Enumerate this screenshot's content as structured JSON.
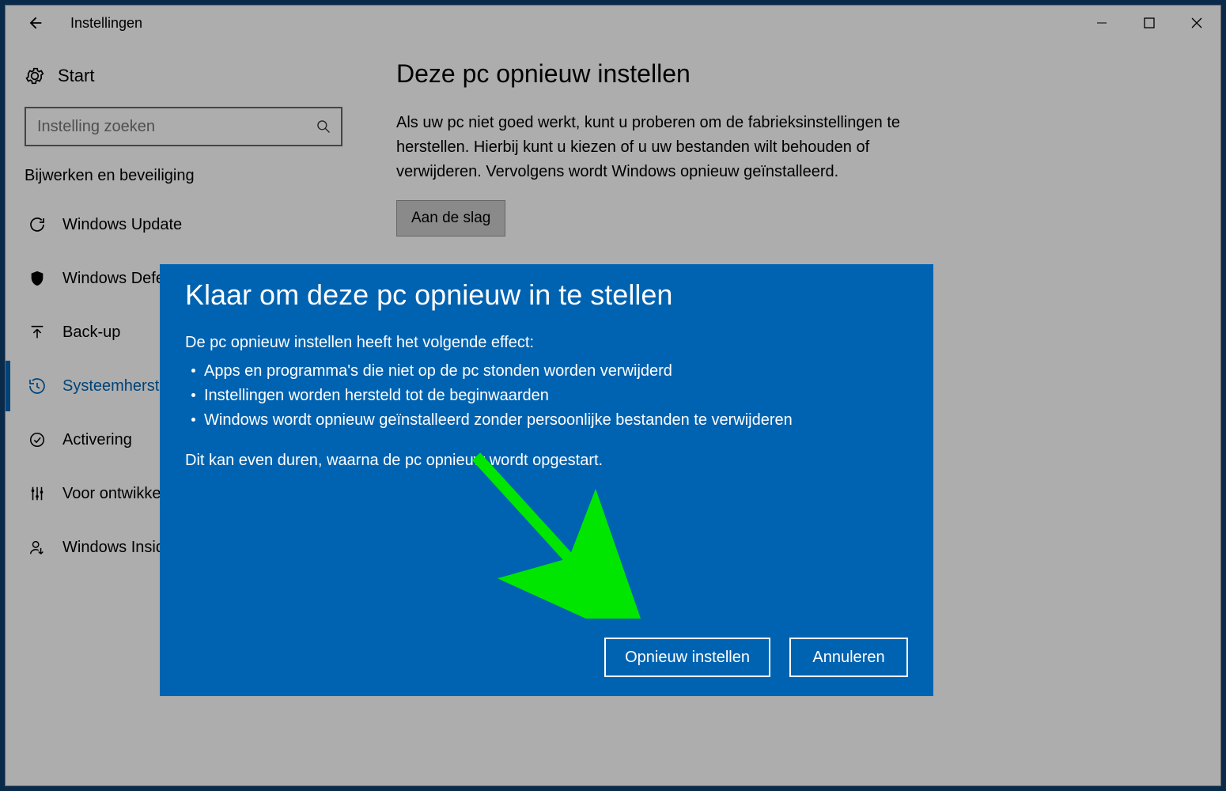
{
  "titlebar": {
    "title": "Instellingen"
  },
  "sidebar": {
    "start": "Start",
    "search_placeholder": "Instelling zoeken",
    "group_header": "Bijwerken en beveiliging",
    "items": [
      {
        "label": "Windows Update"
      },
      {
        "label": "Windows Defender"
      },
      {
        "label": "Back-up"
      },
      {
        "label": "Systeemherstel"
      },
      {
        "label": "Activering"
      },
      {
        "label": "Voor ontwikkelaars"
      },
      {
        "label": "Windows Insider"
      }
    ]
  },
  "main": {
    "heading": "Deze pc opnieuw instellen",
    "description": "Als uw pc niet goed werkt, kunt u proberen om de fabrieksinstellingen te herstellen. Hierbij kunt u kiezen of u uw bestanden wilt behouden of verwijderen. Vervolgens wordt Windows opnieuw geïnstalleerd.",
    "action_label": "Aan de slag"
  },
  "dialog": {
    "title": "Klaar om deze pc opnieuw in te stellen",
    "intro": "De pc opnieuw instellen heeft het volgende effect:",
    "bullets": [
      "Apps en programma's die niet op de pc stonden worden verwijderd",
      "Instellingen worden hersteld tot de beginwaarden",
      "Windows wordt opnieuw geïnstalleerd zonder persoonlijke bestanden te verwijderen"
    ],
    "footnote": "Dit kan even duren, waarna de pc opnieuw wordt opgestart.",
    "primary_label": "Opnieuw instellen",
    "cancel_label": "Annuleren"
  },
  "annotation": {
    "arrow_color": "#00e600"
  }
}
